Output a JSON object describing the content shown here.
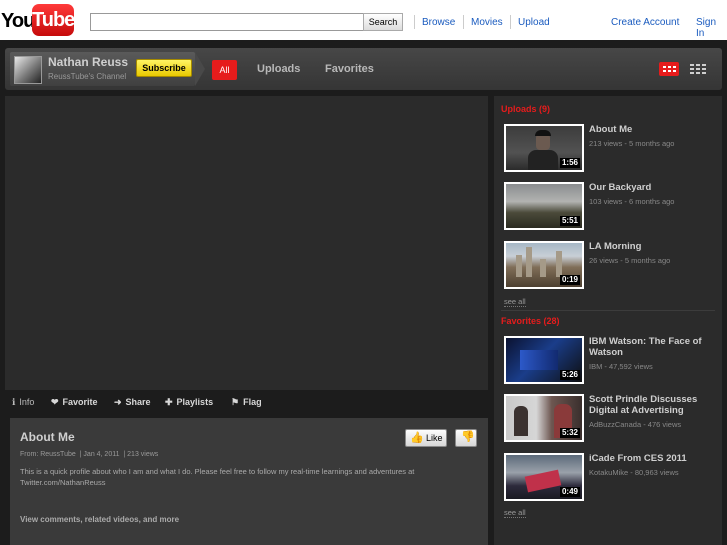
{
  "masthead": {
    "logo_you": "You",
    "logo_tube": "Tube",
    "search_value": "",
    "search_button": "Search",
    "nav": [
      "Browse",
      "Movies",
      "Upload"
    ],
    "create_account": "Create Account",
    "sign_in": "Sign In"
  },
  "channel": {
    "name": "Nathan Reuss",
    "subtitle": "ReussTube's Channel",
    "subscribe_label": "Subscribe",
    "tabs": [
      "All",
      "Uploads",
      "Favorites"
    ]
  },
  "actions": {
    "info": "Info",
    "favorite": "Favorite",
    "share": "Share",
    "playlists": "Playlists",
    "flag": "Flag"
  },
  "video": {
    "title": "About Me",
    "from_label": "From: ReussTube",
    "date": "Jan 4, 2011",
    "views": "213 views",
    "description": "This is a quick profile about who I am and what I do. Please feel free to follow my real-time learnings and adventures at Twitter.com/NathanReuss",
    "more_link": "View comments, related videos, and more",
    "like_label": "Like"
  },
  "uploads": {
    "heading": "Uploads (9)",
    "items": [
      {
        "title": "About Me",
        "meta": "213 views - 5 months ago",
        "duration": "1:56"
      },
      {
        "title": "Our Backyard",
        "meta": "103 views - 6 months ago",
        "duration": "5:51"
      },
      {
        "title": "LA Morning",
        "meta": "26 views - 5 months ago",
        "duration": "0:19"
      }
    ],
    "see_all": "see all"
  },
  "favorites": {
    "heading": "Favorites (28)",
    "items": [
      {
        "title": "IBM Watson: The Face of Watson",
        "meta": "IBM - 47,592 views",
        "duration": "5:26"
      },
      {
        "title": "Scott Prindle Discusses Digital at Advertising",
        "meta": "AdBuzzCanada - 476 views",
        "duration": "5:32"
      },
      {
        "title": "iCade From CES 2011",
        "meta": "KotakuMike - 80,963 views",
        "duration": "0:49"
      }
    ],
    "see_all": "see all"
  },
  "colors": {
    "accent_red": "#e61c1c",
    "subscribe_yellow": "#f5e22b",
    "link_blue": "#1a5bbf",
    "page_dark": "#1c1c1c"
  },
  "icons": [
    "info-icon",
    "heart-icon",
    "arrow-right-icon",
    "plus-icon",
    "flag-icon",
    "thumbs-up-icon",
    "thumbs-down-icon",
    "grid-view-icon",
    "list-view-icon"
  ]
}
